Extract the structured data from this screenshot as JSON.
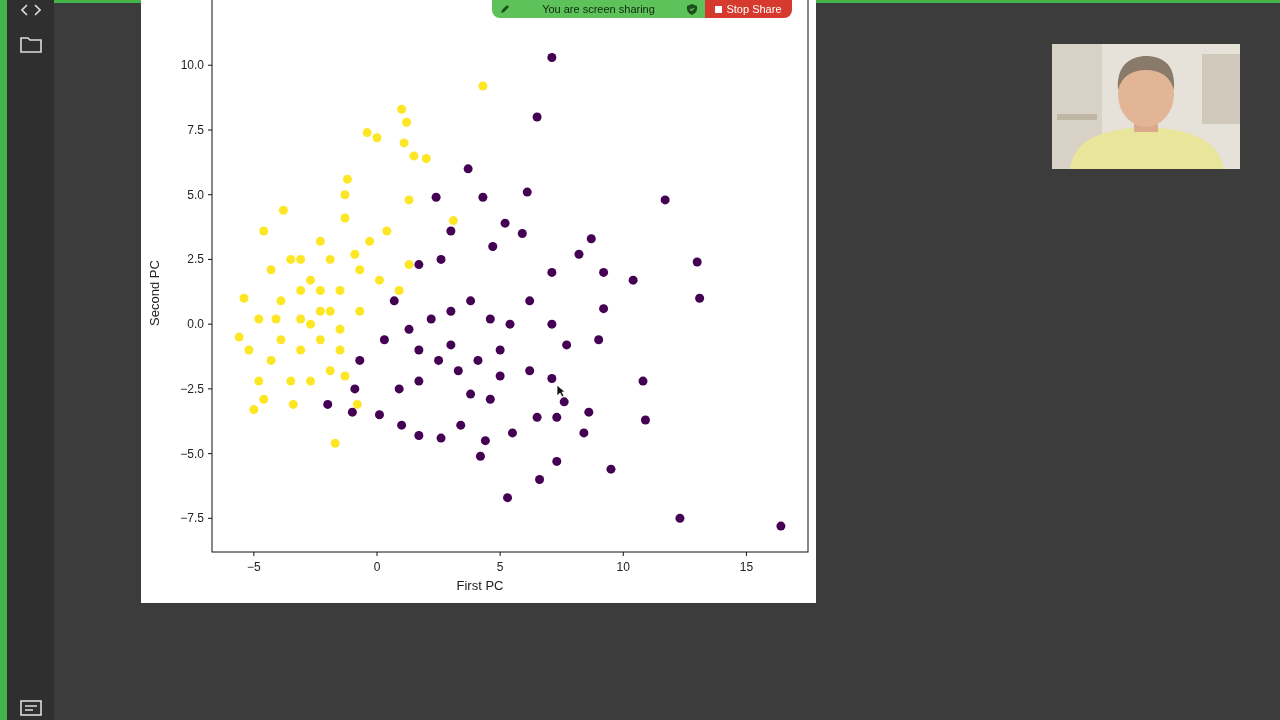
{
  "sharing_bar": {
    "message": "You are screen sharing",
    "stop_button": "Stop Share"
  },
  "figure": {
    "chart_data": {
      "type": "scatter",
      "xlabel": "First PC",
      "ylabel": "Second PC",
      "xlim": [
        -6.7,
        17.5
      ],
      "ylim": [
        -8.8,
        13.1
      ],
      "xticks": [
        {
          "value": -5,
          "label": "−5"
        },
        0,
        5,
        10,
        15
      ],
      "yticks": [
        {
          "value": -7.5,
          "label": "−7.5"
        },
        {
          "value": -5,
          "label": "−5.0"
        },
        {
          "value": -2.5,
          "label": "−2.5"
        },
        {
          "value": 0,
          "label": "0.0"
        },
        {
          "value": 2.5,
          "label": "2.5"
        },
        {
          "value": 5,
          "label": "5.0"
        },
        {
          "value": 7.5,
          "label": "7.5"
        },
        {
          "value": 10,
          "label": "10.0"
        }
      ],
      "series": [
        {
          "color": "#440154",
          "x": [
            7.1,
            6.5,
            3.7,
            6.1,
            11.7,
            2.4,
            4.3,
            8.7,
            13.0,
            13.1,
            10.4,
            9.2,
            8.2,
            7.1,
            5.9,
            5.2,
            4.7,
            3.0,
            2.6,
            1.7,
            9.2,
            9.0,
            7.7,
            7.1,
            6.2,
            5.4,
            4.6,
            3.8,
            3.0,
            2.2,
            1.3,
            0.7,
            0.3,
            -0.7,
            -0.9,
            -2.0,
            -1.0,
            0.1,
            0.9,
            1.7,
            2.5,
            3.3,
            4.1,
            5.0,
            6.2,
            7.1,
            7.6,
            8.6,
            8.4,
            10.8,
            10.9,
            6.5,
            7.3,
            5.5,
            4.2,
            4.4,
            3.4,
            2.6,
            1.7,
            1.0,
            7.3,
            6.6,
            9.5,
            5.3,
            12.3,
            16.4,
            3.8,
            4.6,
            3.0,
            1.7,
            5.0
          ],
          "values": [
            10.3,
            8.0,
            6.0,
            5.1,
            4.8,
            4.9,
            4.9,
            3.3,
            2.4,
            1.0,
            1.7,
            2.0,
            2.7,
            2.0,
            3.5,
            3.9,
            3.0,
            3.6,
            2.5,
            2.3,
            0.6,
            -0.6,
            -0.8,
            0.0,
            0.9,
            0.0,
            0.2,
            0.9,
            0.5,
            0.2,
            -0.2,
            0.9,
            -0.6,
            -1.4,
            -2.5,
            -3.1,
            -3.4,
            -3.5,
            -2.5,
            -2.2,
            -1.4,
            -1.8,
            -1.4,
            -2.0,
            -1.8,
            -2.1,
            -3.0,
            -3.4,
            -4.2,
            -2.2,
            -3.7,
            -3.6,
            -3.6,
            -4.2,
            -5.1,
            -4.5,
            -3.9,
            -4.4,
            -4.3,
            -3.9,
            -5.3,
            -6.0,
            -5.6,
            -6.7,
            -7.5,
            -7.8,
            -2.7,
            -2.9,
            -0.8,
            -1.0,
            -1.0
          ]
        },
        {
          "color": "#fde725",
          "x": [
            4.3,
            1.0,
            1.2,
            -0.4,
            0.0,
            1.1,
            1.5,
            2.0,
            -1.2,
            -1.3,
            -3.8,
            -4.6,
            0.4,
            -1.3,
            1.3,
            3.1,
            -2.3,
            -3.1,
            -4.3,
            -5.4,
            -5.6,
            -4.8,
            -3.9,
            -3.1,
            -2.3,
            -1.5,
            -0.7,
            0.1,
            0.9,
            1.3,
            -3.1,
            -2.3,
            -1.5,
            -0.7,
            -4.3,
            -4.8,
            -5.0,
            -4.6,
            -3.4,
            -2.7,
            -1.9,
            -1.3,
            -0.8,
            -1.7,
            -3.5,
            -2.7,
            -1.9,
            -3.9,
            -3.1,
            -2.3,
            -3.5,
            -0.3,
            -0.9,
            -2.7,
            -1.9,
            -1.5,
            -5.2,
            -4.1
          ],
          "values": [
            9.2,
            8.3,
            7.8,
            7.4,
            7.2,
            7.0,
            6.5,
            6.4,
            5.6,
            5.0,
            4.4,
            3.6,
            3.6,
            4.1,
            4.8,
            4.0,
            3.2,
            2.5,
            2.1,
            1.0,
            -0.5,
            0.2,
            0.9,
            0.2,
            0.5,
            1.3,
            2.1,
            1.7,
            1.3,
            2.3,
            -1.0,
            -0.6,
            -0.2,
            0.5,
            -1.4,
            -2.2,
            -3.3,
            -2.9,
            -3.1,
            -2.2,
            -1.8,
            -2.0,
            -3.1,
            -4.6,
            2.5,
            1.7,
            2.5,
            -0.6,
            1.3,
            1.3,
            -2.2,
            3.2,
            2.7,
            0.0,
            0.5,
            -1.0,
            -1.0,
            0.2
          ]
        }
      ]
    }
  }
}
